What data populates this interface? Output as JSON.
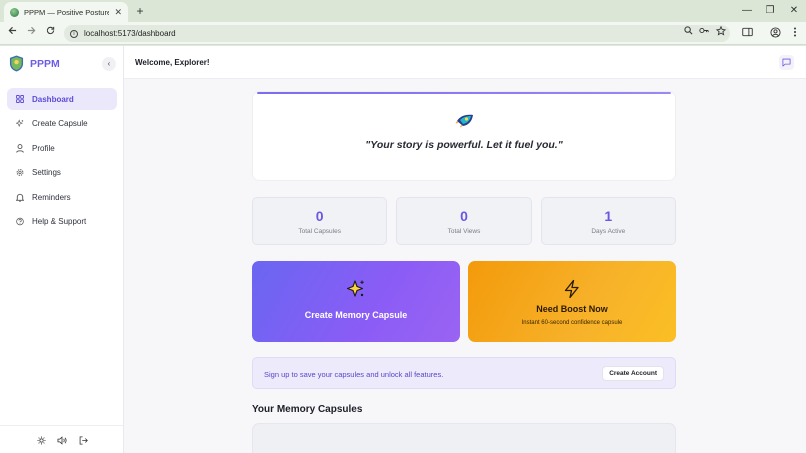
{
  "browser": {
    "tab_title": "PPPM — Positive Posture Prese",
    "tab_close": "✕",
    "new_tab": "+",
    "url": "localhost:5173/dashboard",
    "window": {
      "minimize": "—",
      "restore": "❐",
      "close": "✕"
    }
  },
  "app": {
    "brand": "PPPM",
    "collapse": "‹",
    "header": {
      "welcome": "Welcome, Explorer!"
    },
    "nav": [
      {
        "label": "Dashboard",
        "icon": "grid-icon",
        "active": true
      },
      {
        "label": "Create Capsule",
        "icon": "sparkles-icon",
        "active": false
      },
      {
        "label": "Profile",
        "icon": "user-icon",
        "active": false
      },
      {
        "label": "Settings",
        "icon": "gear-icon",
        "active": false
      },
      {
        "label": "Reminders",
        "icon": "bell-icon",
        "active": false
      },
      {
        "label": "Help & Support",
        "icon": "help-icon",
        "active": false
      }
    ],
    "quote": "\"Your story is powerful. Let it fuel you.\"",
    "stats": [
      {
        "value": "0",
        "label": "Total Capsules"
      },
      {
        "value": "0",
        "label": "Total Views"
      },
      {
        "value": "1",
        "label": "Days Active"
      }
    ],
    "actions": {
      "create": {
        "title": "Create Memory Capsule"
      },
      "boost": {
        "title": "Need Boost Now",
        "subtitle": "Instant 60-second confidence capsule"
      }
    },
    "signup": {
      "text": "Sign up to save your capsules and unlock all features.",
      "button": "Create Account"
    },
    "capsules_title": "Your Memory Capsules"
  },
  "colors": {
    "accent": "#6d5ce6",
    "create_card": "#8b5cf6",
    "boost_card": "#f7b22a"
  }
}
